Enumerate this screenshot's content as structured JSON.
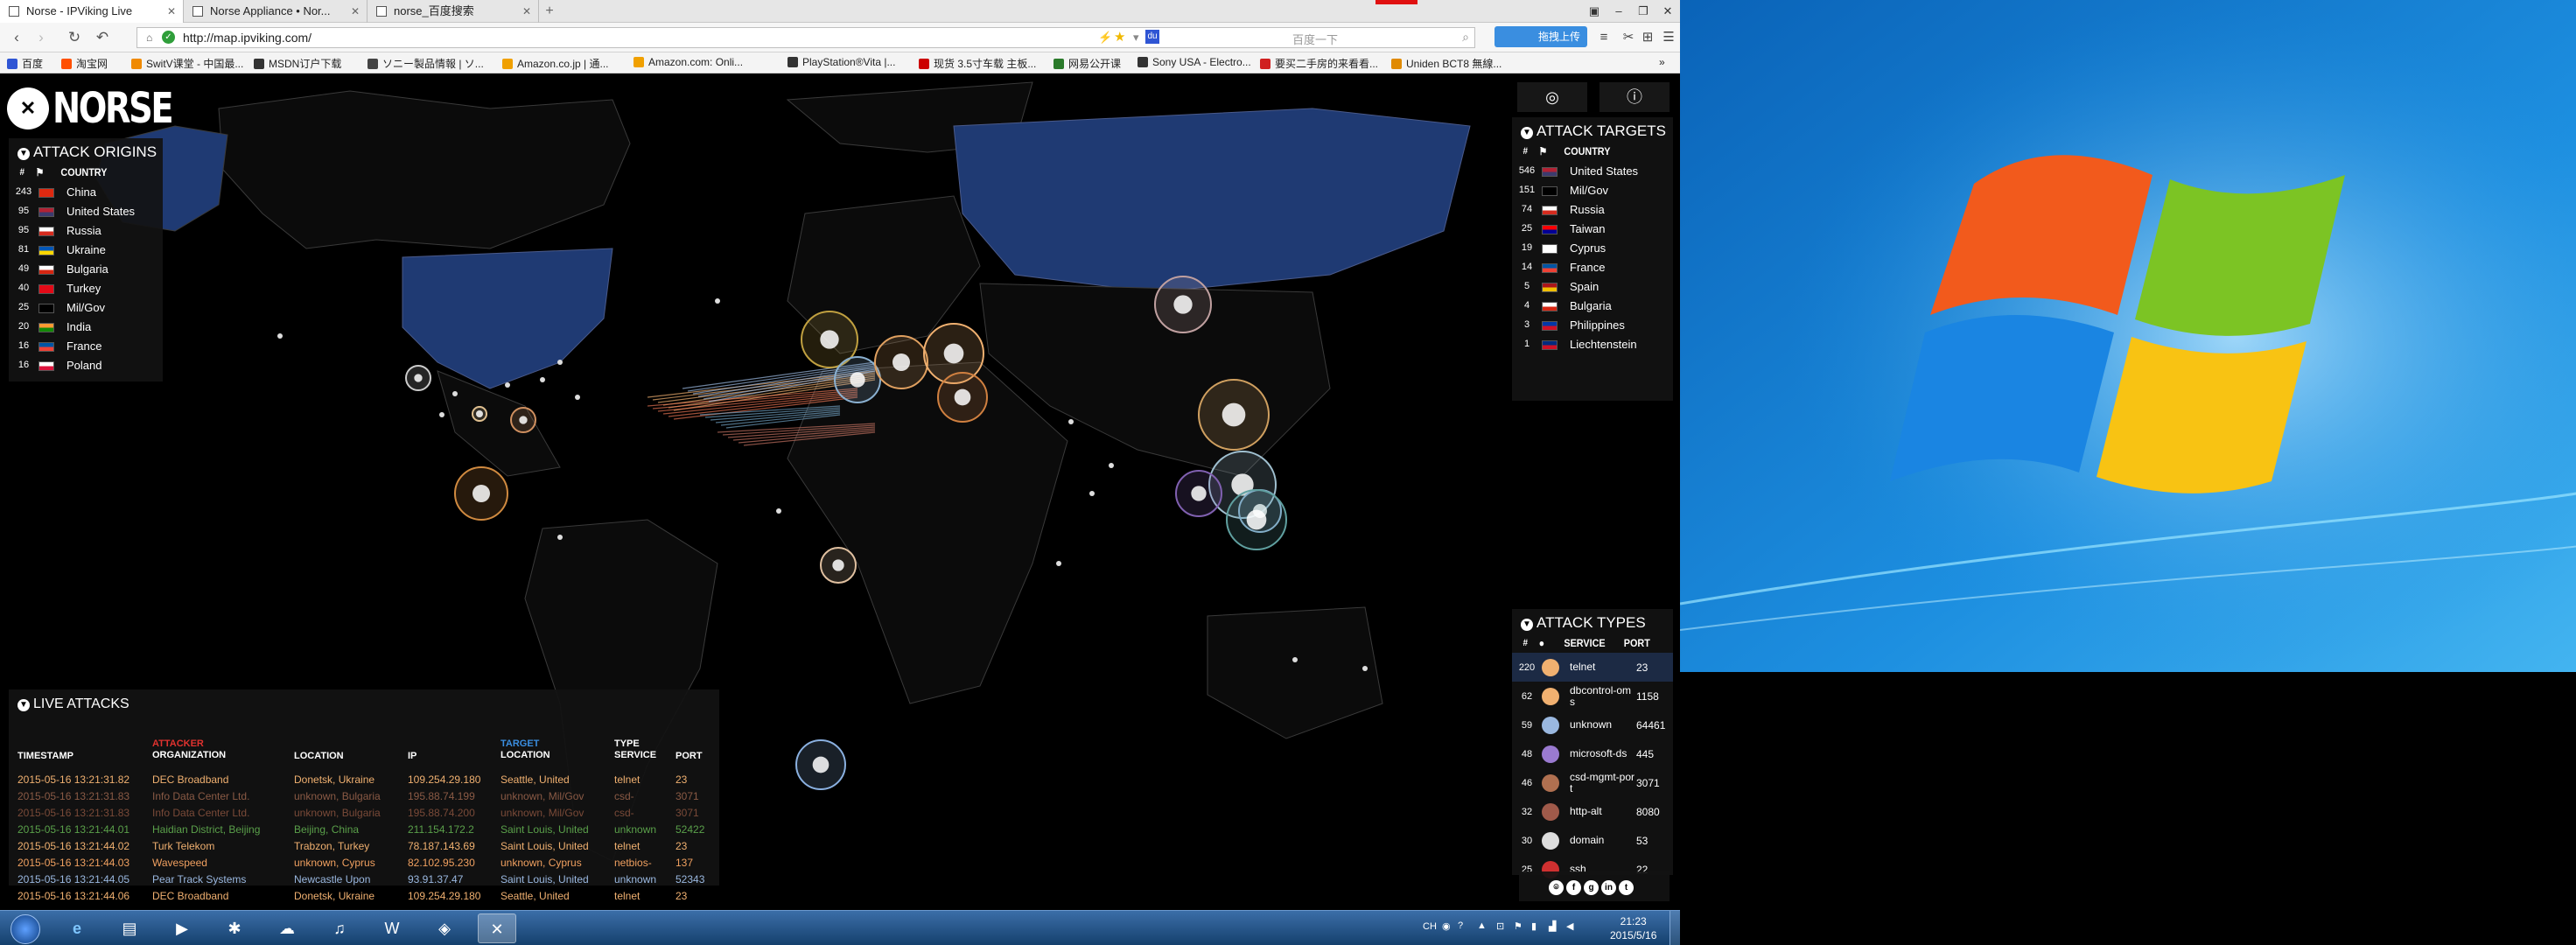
{
  "browser": {
    "tabs": [
      {
        "title": "Norse - IPViking Live"
      },
      {
        "title": "Norse Appliance • Nor..."
      },
      {
        "title": "norse_百度搜索"
      }
    ],
    "url": "http://map.ipviking.com/",
    "search_placeholder": "百度一下",
    "tool_label": "拖拽上传",
    "bookmarks": [
      "百度",
      "淘宝网",
      "SwitV课堂 - 中国最...",
      "MSDN订户下载",
      "ソニー製品情報 | ソ...",
      "Amazon.co.jp | 通...",
      "Amazon.com: Onli...",
      "PlayStation®Vita |...",
      "现货 3.5寸车载 主板...",
      "网易公开课",
      "Sony USA - Electro...",
      "要买二手房的来看看...",
      "Uniden BCT8 無線..."
    ]
  },
  "app": {
    "name": "NORSE"
  },
  "origins": {
    "title": "ATTACK ORIGINS",
    "country_header": "COUNTRY",
    "rows": [
      {
        "count": "243",
        "country": "China",
        "f1": "#de2910",
        "f2": "#de2910"
      },
      {
        "count": "95",
        "country": "United States",
        "f1": "#b22234",
        "f2": "#3c3b6e"
      },
      {
        "count": "95",
        "country": "Russia",
        "f1": "#ffffff",
        "f2": "#d52b1e"
      },
      {
        "count": "81",
        "country": "Ukraine",
        "f1": "#0057b7",
        "f2": "#ffd700"
      },
      {
        "count": "49",
        "country": "Bulgaria",
        "f1": "#ffffff",
        "f2": "#d62612"
      },
      {
        "count": "40",
        "country": "Turkey",
        "f1": "#e30a17",
        "f2": "#e30a17"
      },
      {
        "count": "25",
        "country": "Mil/Gov",
        "f1": "#000000",
        "f2": "#000000"
      },
      {
        "count": "20",
        "country": "India",
        "f1": "#ff9933",
        "f2": "#138808"
      },
      {
        "count": "16",
        "country": "France",
        "f1": "#0055a4",
        "f2": "#ef4135"
      },
      {
        "count": "16",
        "country": "Poland",
        "f1": "#ffffff",
        "f2": "#dc143c"
      }
    ]
  },
  "targets": {
    "title": "ATTACK TARGETS",
    "country_header": "COUNTRY",
    "rows": [
      {
        "count": "546",
        "country": "United States",
        "f1": "#b22234",
        "f2": "#3c3b6e"
      },
      {
        "count": "151",
        "country": "Mil/Gov",
        "f1": "#000000",
        "f2": "#000000"
      },
      {
        "count": "74",
        "country": "Russia",
        "f1": "#ffffff",
        "f2": "#d52b1e"
      },
      {
        "count": "25",
        "country": "Taiwan",
        "f1": "#fe0000",
        "f2": "#000095"
      },
      {
        "count": "19",
        "country": "Cyprus",
        "f1": "#ffffff",
        "f2": "#ffffff"
      },
      {
        "count": "14",
        "country": "France",
        "f1": "#0055a4",
        "f2": "#ef4135"
      },
      {
        "count": "5",
        "country": "Spain",
        "f1": "#aa151b",
        "f2": "#f1bf00"
      },
      {
        "count": "4",
        "country": "Bulgaria",
        "f1": "#ffffff",
        "f2": "#d62612"
      },
      {
        "count": "3",
        "country": "Philippines",
        "f1": "#0038a8",
        "f2": "#ce1126"
      },
      {
        "count": "1",
        "country": "Liechtenstein",
        "f1": "#002b7f",
        "f2": "#ce1126"
      }
    ]
  },
  "types": {
    "title": "ATTACK TYPES",
    "service_header": "SERVICE",
    "port_header": "PORT",
    "rows": [
      {
        "count": "220",
        "service": "telnet",
        "port": "23",
        "color": "#f0b070"
      },
      {
        "count": "62",
        "service": "dbcontrol-oms",
        "port": "1158",
        "color": "#f0b070"
      },
      {
        "count": "59",
        "service": "unknown",
        "port": "64461",
        "color": "#9ab8e0"
      },
      {
        "count": "48",
        "service": "microsoft-ds",
        "port": "445",
        "color": "#9a7ad0"
      },
      {
        "count": "46",
        "service": "csd-mgmt-port",
        "port": "3071",
        "color": "#b07050"
      },
      {
        "count": "32",
        "service": "http-alt",
        "port": "8080",
        "color": "#a05a4a"
      },
      {
        "count": "30",
        "service": "domain",
        "port": "53",
        "color": "#dddddd"
      },
      {
        "count": "25",
        "service": "ssh",
        "port": "22",
        "color": "#d03030"
      }
    ]
  },
  "live": {
    "title": "LIVE ATTACKS",
    "headers": {
      "timestamp": "TIMESTAMP",
      "attacker": "ATTACKER",
      "organization": "ORGANIZATION",
      "location": "LOCATION",
      "ip": "IP",
      "target": "TARGET",
      "tlocation": "LOCATION",
      "type": "TYPE",
      "service": "SERVICE",
      "port": "PORT"
    },
    "rows": [
      {
        "ts": "2015-05-16  13:21:31.82",
        "org": "DEC Broadband",
        "loc": "Donetsk, Ukraine",
        "ip": "109.254.29.180",
        "tloc": "Seattle, United",
        "svc": "telnet",
        "port": "23",
        "color": "#f0b070"
      },
      {
        "ts": "2015-05-16  13:21:31.83",
        "org": "Info Data Center Ltd.",
        "loc": "unknown, Bulgaria",
        "ip": "195.88.74.199",
        "tloc": "unknown, Mil/Gov",
        "svc": "csd-",
        "port": "3071",
        "color": "#8a5a45"
      },
      {
        "ts": "2015-05-16  13:21:31.83",
        "org": "Info Data Center Ltd.",
        "loc": "unknown, Bulgaria",
        "ip": "195.88.74.200",
        "tloc": "unknown, Mil/Gov",
        "svc": "csd-",
        "port": "3071",
        "color": "#7a4a38"
      },
      {
        "ts": "2015-05-16  13:21:44.01",
        "org": "Haidian District, Beijing",
        "loc": "Beijing, China",
        "ip": "211.154.172.2",
        "tloc": "Saint Louis, United",
        "svc": "unknown",
        "port": "52422",
        "color": "#5aa04a"
      },
      {
        "ts": "2015-05-16  13:21:44.02",
        "org": "Turk Telekom",
        "loc": "Trabzon, Turkey",
        "ip": "78.187.143.69",
        "tloc": "Saint Louis, United",
        "svc": "telnet",
        "port": "23",
        "color": "#f0b070"
      },
      {
        "ts": "2015-05-16  13:21:44.03",
        "org": "Wavespeed",
        "loc": "unknown, Cyprus",
        "ip": "82.102.95.230",
        "tloc": "unknown, Cyprus",
        "svc": "netbios-",
        "port": "137",
        "color": "#f0a060"
      },
      {
        "ts": "2015-05-16  13:21:44.05",
        "org": "Pear Track Systems",
        "loc": "Newcastle Upon",
        "ip": "93.91.37.47",
        "tloc": "Saint Louis, United",
        "svc": "unknown",
        "port": "52343",
        "color": "#9ab8e0"
      },
      {
        "ts": "2015-05-16  13:21:44.06",
        "org": "DEC Broadband",
        "loc": "Donetsk, Ukraine",
        "ip": "109.254.29.180",
        "tloc": "Seattle, United",
        "svc": "telnet",
        "port": "23",
        "color": "#f0b070"
      }
    ]
  },
  "taskbar": {
    "time": "21:23",
    "date": "2015/5/16",
    "lang": "CH"
  },
  "colors": {
    "land": "#0b0b0b",
    "us_ru": "#1f3a73",
    "attacker_hdr": "#e0322f",
    "target_hdr": "#3a8ee0"
  }
}
